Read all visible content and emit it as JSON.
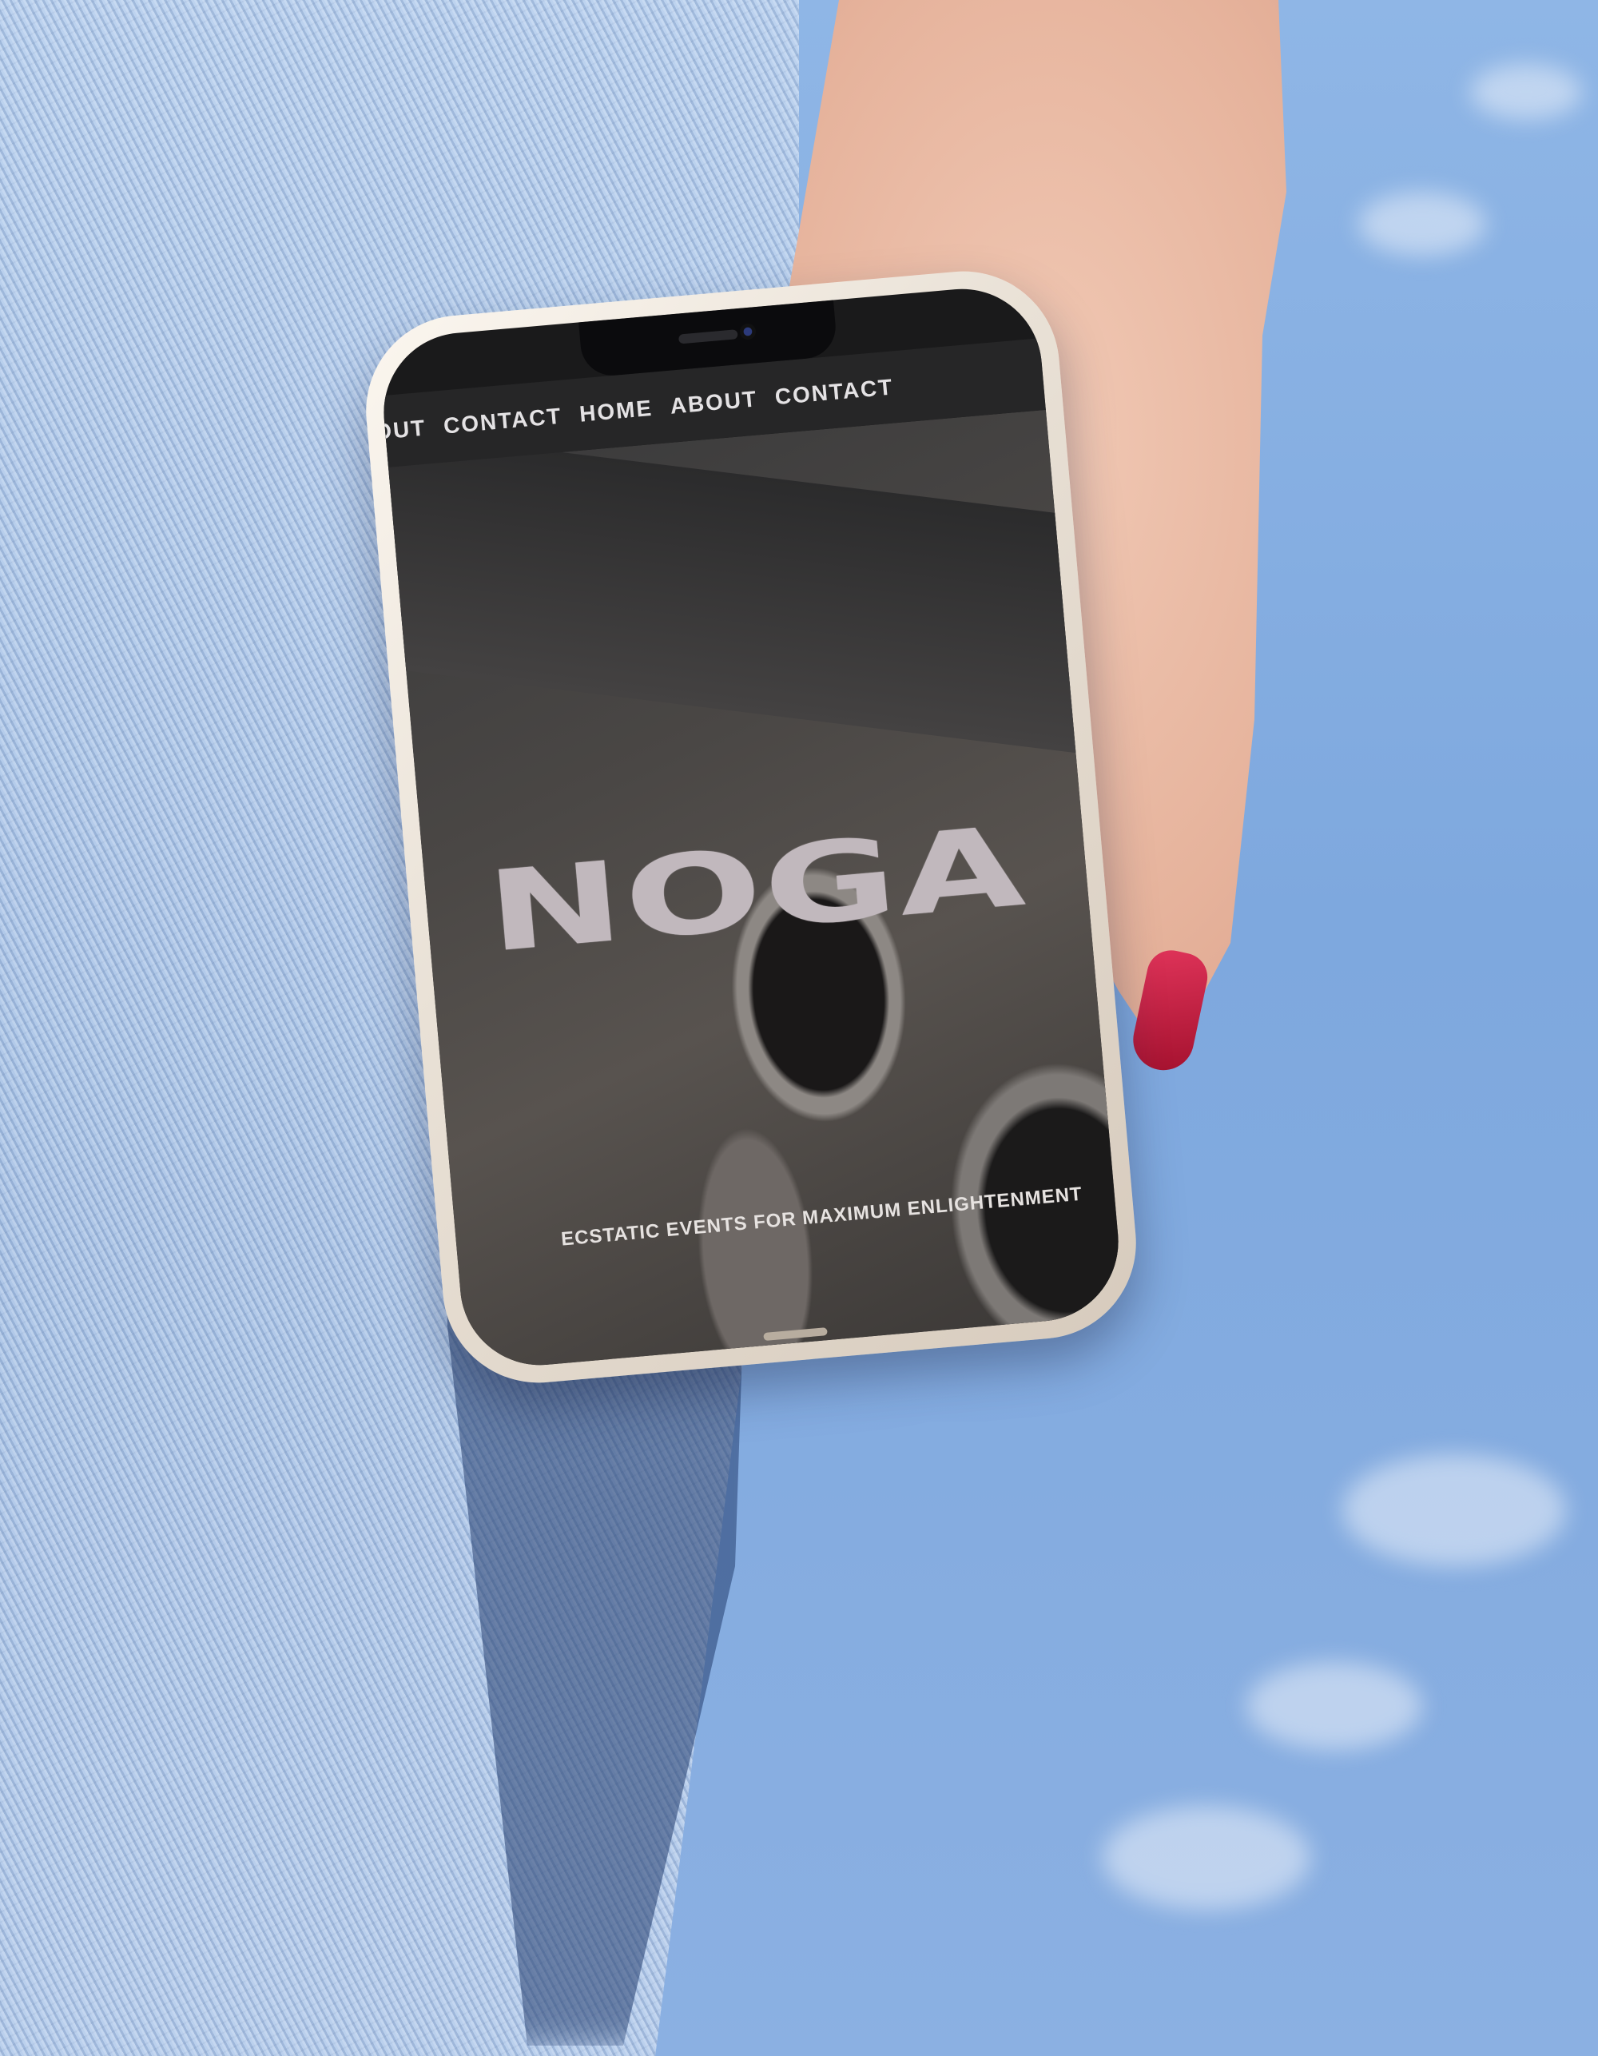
{
  "site": {
    "nav": {
      "items": [
        "BOUT",
        "CONTACT",
        "HOME",
        "ABOUT",
        "CONTACT"
      ]
    },
    "hero": {
      "title": "NOGA",
      "tagline": "ECSTATIC EVENTS FOR MAXIMUM ENLIGHTENMENT"
    }
  },
  "colors": {
    "nav_background": "#262627",
    "title_color": "#c1b8bd",
    "nail_polish": "#c21c3f"
  }
}
